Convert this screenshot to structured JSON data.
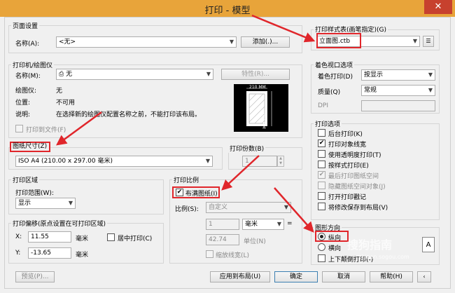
{
  "window": {
    "title": "打印 - 模型",
    "close": "✕"
  },
  "page_setup": {
    "legend": "页面设置",
    "name_label": "名称(A):",
    "name_value": "<无>",
    "add_button": "添加(.)..."
  },
  "printer": {
    "legend": "打印机/绘图仪",
    "name_label": "名称(M):",
    "name_value": "无",
    "properties_button": "特性(R)...",
    "plotter_label": "绘图仪:",
    "plotter_value": "无",
    "location_label": "位置:",
    "location_value": "不可用",
    "desc_label": "说明:",
    "desc_value": "在选择新的绘图仪配置名称之前，不能打印该布局。",
    "print_to_file": "打印到文件(F)",
    "preview_width": "210 MM",
    "preview_height": "297 MM"
  },
  "paper_size": {
    "legend": "图纸尺寸(Z)",
    "value": "ISO A4 (210.00 x 297.00 毫米)"
  },
  "copies": {
    "legend": "打印份数(B)",
    "value": "1"
  },
  "plot_area": {
    "legend": "打印区域",
    "range_label": "打印范围(W):",
    "range_value": "显示"
  },
  "plot_offset": {
    "legend": "打印偏移(原点设置在可打印区域)",
    "x_label": "X:",
    "x_value": "11.55",
    "x_unit": "毫米",
    "y_label": "Y:",
    "y_value": "-13.65",
    "y_unit": "毫米",
    "center": "居中打印(C)"
  },
  "plot_scale": {
    "legend": "打印比例",
    "fit": "布满图纸(I)",
    "scale_label": "比例(S):",
    "scale_value": "自定义",
    "num1": "1",
    "unit_combo": "毫米",
    "equals": "=",
    "num2": "42.74",
    "unit_label": "单位(N)",
    "lineweights": "缩放线宽(L)"
  },
  "style_table": {
    "legend": "打印样式表(画笔指定)(G)",
    "value": "立面图.ctb"
  },
  "shaded": {
    "legend": "着色视口选项",
    "shade_label": "着色打印(D)",
    "shade_value": "按显示",
    "quality_label": "质量(Q)",
    "quality_value": "常规",
    "dpi_label": "DPI"
  },
  "options": {
    "legend": "打印选项",
    "items": [
      {
        "label": "后台打印(K)",
        "checked": "",
        "disabled": false
      },
      {
        "label": "打印对象线宽",
        "checked": "✔",
        "disabled": false
      },
      {
        "label": "使用透明度打印(T)",
        "checked": "",
        "disabled": false
      },
      {
        "label": "按样式打印(E)",
        "checked": "",
        "disabled": false
      },
      {
        "label": "最后打印图纸空间",
        "checked": "✔",
        "disabled": true
      },
      {
        "label": "隐藏图纸空间对象(J)",
        "checked": "",
        "disabled": true
      },
      {
        "label": "打开打印戳记",
        "checked": "",
        "disabled": false
      },
      {
        "label": "将修改保存到布局(V)",
        "checked": "",
        "disabled": false
      }
    ]
  },
  "orientation": {
    "legend": "图形方向",
    "portrait": "纵向",
    "landscape": "横向",
    "upside_down": "上下颠倒打印(-)"
  },
  "footer": {
    "preview": "预览(P)...",
    "apply": "应用到布局(U)",
    "ok": "确定",
    "cancel": "取消",
    "help": "帮助(H)"
  },
  "watermark": {
    "brand": "搜狗指南",
    "url": "zhinan.sogou.com"
  },
  "colors": {
    "titlebar": "#e8a43a",
    "close": "#c7412e",
    "highlight": "#e0262b"
  }
}
